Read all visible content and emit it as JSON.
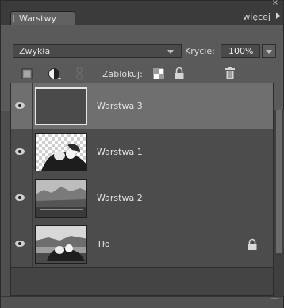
{
  "panel": {
    "title": "Warstwy",
    "more_label": "więcej"
  },
  "blend": {
    "mode": "Zwykła"
  },
  "opacity": {
    "label": "Krycie:",
    "value": "100%"
  },
  "lock": {
    "label": "Zablokuj:"
  },
  "layers": [
    {
      "name": "Warstwa 3",
      "selected": true,
      "visible": true,
      "thumbnail": "empty",
      "locked": false
    },
    {
      "name": "Warstwa 1",
      "selected": false,
      "visible": true,
      "thumbnail": "transparent-photo",
      "locked": false
    },
    {
      "name": "Warstwa 2",
      "selected": false,
      "visible": true,
      "thumbnail": "landscape-photo",
      "locked": false
    },
    {
      "name": "Tło",
      "selected": false,
      "visible": true,
      "thumbnail": "couple-photo",
      "locked": true
    }
  ],
  "colors": {
    "panel_bg": "#4e4e4e",
    "selected_row": "#6f6f6f",
    "text": "#e4e4e4"
  }
}
